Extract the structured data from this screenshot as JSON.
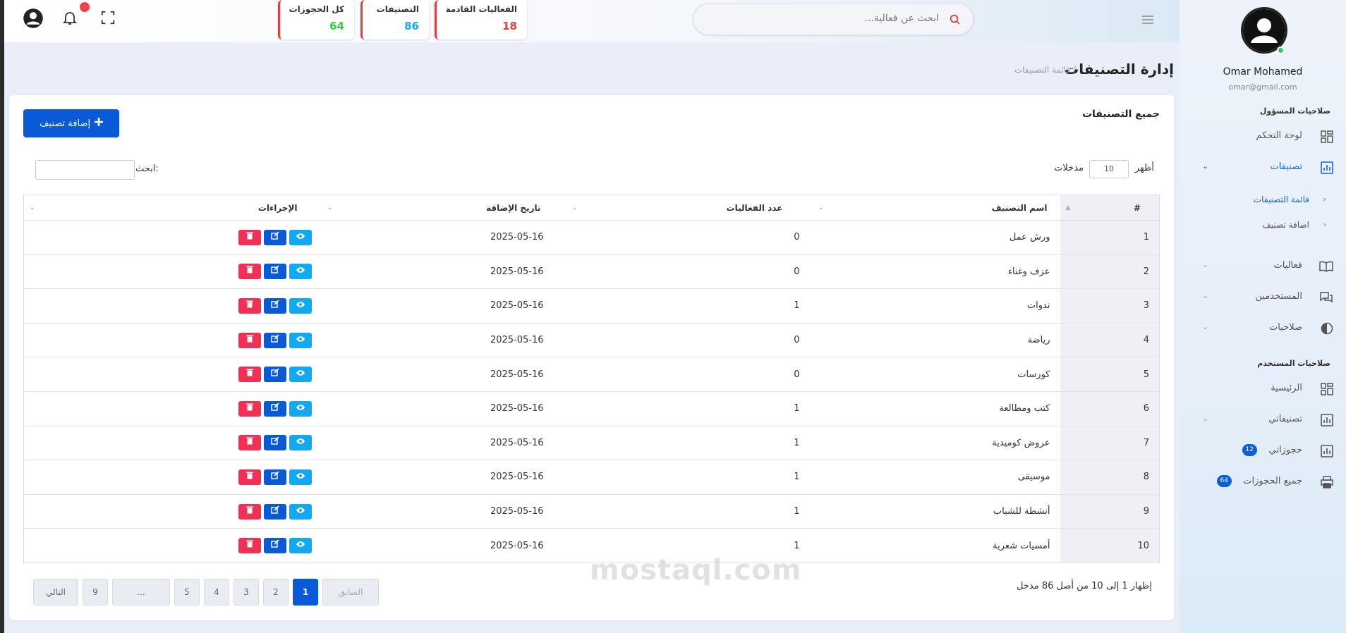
{
  "header": {
    "search_placeholder": "ابحث عن فعالية...",
    "stats": [
      {
        "title": "الفعاليات القادمة",
        "value": "18",
        "color": "#e53e3e"
      },
      {
        "title": "التصنيفات",
        "value": "86",
        "color": "#12a9f0"
      },
      {
        "title": "كل الحجوزات",
        "value": "64",
        "color": "#2ecc40"
      }
    ]
  },
  "sidebar": {
    "user_name": "Omar Mohamed",
    "user_email": "omar@gmail.com",
    "admin_section": "صلاحيات المسؤول",
    "user_section": "صلاحيات المستخدم",
    "items": {
      "dashboard": "لوحة التحكم",
      "categories": "تصنيفات",
      "sub_list": "قائمة التصنيفات",
      "sub_add": "اضافة تصنيف",
      "events": "فعاليات",
      "users": "المستخدمين",
      "permissions": "صلاحيات",
      "home": "الرئيسية",
      "my_categories": "تصنيفاتي",
      "my_bookings": "حجوزاتي",
      "my_bookings_badge": "12",
      "all_bookings": "جميع الحجوزات",
      "all_bookings_badge": "64"
    }
  },
  "page": {
    "title": "إدارة التصنيفات",
    "breadcrumb": "/ قائمة التصنيفات"
  },
  "card": {
    "title": "جميع التصنيفات",
    "add_button": "إضافة تصنيف",
    "show_label": "أظهر",
    "entries_value": "10",
    "entries_label": "مدخلات",
    "search_label": "ابحث:"
  },
  "table": {
    "headers": {
      "num": "#",
      "name": "اسم التصنيف",
      "count": "عدد الفعاليات",
      "date": "تاريخ الإضافة",
      "actions": "الإجراءات"
    },
    "rows": [
      {
        "num": "1",
        "name": "ورش عمل",
        "count": "0",
        "date": "2025-05-16"
      },
      {
        "num": "2",
        "name": "عزف وغناء",
        "count": "0",
        "date": "2025-05-16"
      },
      {
        "num": "3",
        "name": "ندوات",
        "count": "1",
        "date": "2025-05-16"
      },
      {
        "num": "4",
        "name": "رياضة",
        "count": "0",
        "date": "2025-05-16"
      },
      {
        "num": "5",
        "name": "كورسات",
        "count": "0",
        "date": "2025-05-16"
      },
      {
        "num": "6",
        "name": "كتب ومطالعة",
        "count": "1",
        "date": "2025-05-16"
      },
      {
        "num": "7",
        "name": "عروض كوميدية",
        "count": "1",
        "date": "2025-05-16"
      },
      {
        "num": "8",
        "name": "موسيقى",
        "count": "1",
        "date": "2025-05-16"
      },
      {
        "num": "9",
        "name": "أنشطة للشباب",
        "count": "1",
        "date": "2025-05-16"
      },
      {
        "num": "10",
        "name": "أمسيات شعرية",
        "count": "1",
        "date": "2025-05-16"
      }
    ]
  },
  "footer": {
    "info": "إظهار 1 إلى 10 من أصل 86 مدخل",
    "pagination": [
      "السابق",
      "1",
      "2",
      "3",
      "4",
      "5",
      "...",
      "9",
      "التالي"
    ]
  },
  "watermark": "mostaql.com"
}
